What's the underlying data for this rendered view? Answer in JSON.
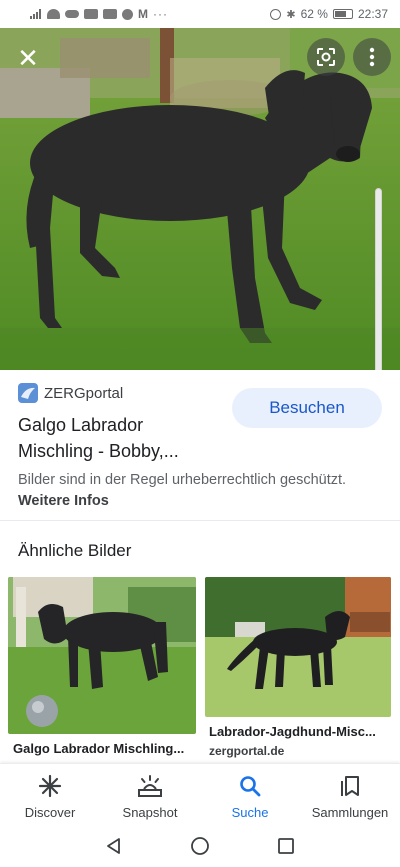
{
  "status_bar": {
    "battery": "62 %",
    "time": "22:37"
  },
  "hero": {
    "close_icon": "close-icon",
    "lens_icon": "lens-icon",
    "more_icon": "more-vert-icon"
  },
  "result": {
    "source_name": "ZERGportal",
    "title": "Galgo Labrador Mischling - Bobby,...",
    "visit_label": "Besuchen",
    "copyright_text": "Bilder sind in der Regel urheberrechtlich geschützt.",
    "more_info_label": "Weitere Infos"
  },
  "similar": {
    "heading": "Ähnliche Bilder",
    "items": [
      {
        "title": "Galgo Labrador Mischling..."
      },
      {
        "title": "Labrador-Jagdhund-Misc...",
        "source": "zergportal.de"
      }
    ]
  },
  "bottom_nav": {
    "items": [
      {
        "label": "Discover",
        "icon": "asterisk-icon"
      },
      {
        "label": "Snapshot",
        "icon": "snapshot-icon"
      },
      {
        "label": "Suche",
        "icon": "search-icon"
      },
      {
        "label": "Sammlungen",
        "icon": "collections-icon"
      }
    ],
    "active": "Suche"
  },
  "colors": {
    "accent": "#1a73e8",
    "visit_button_bg": "#e8f0fe",
    "visit_button_text": "#1a57c8"
  }
}
